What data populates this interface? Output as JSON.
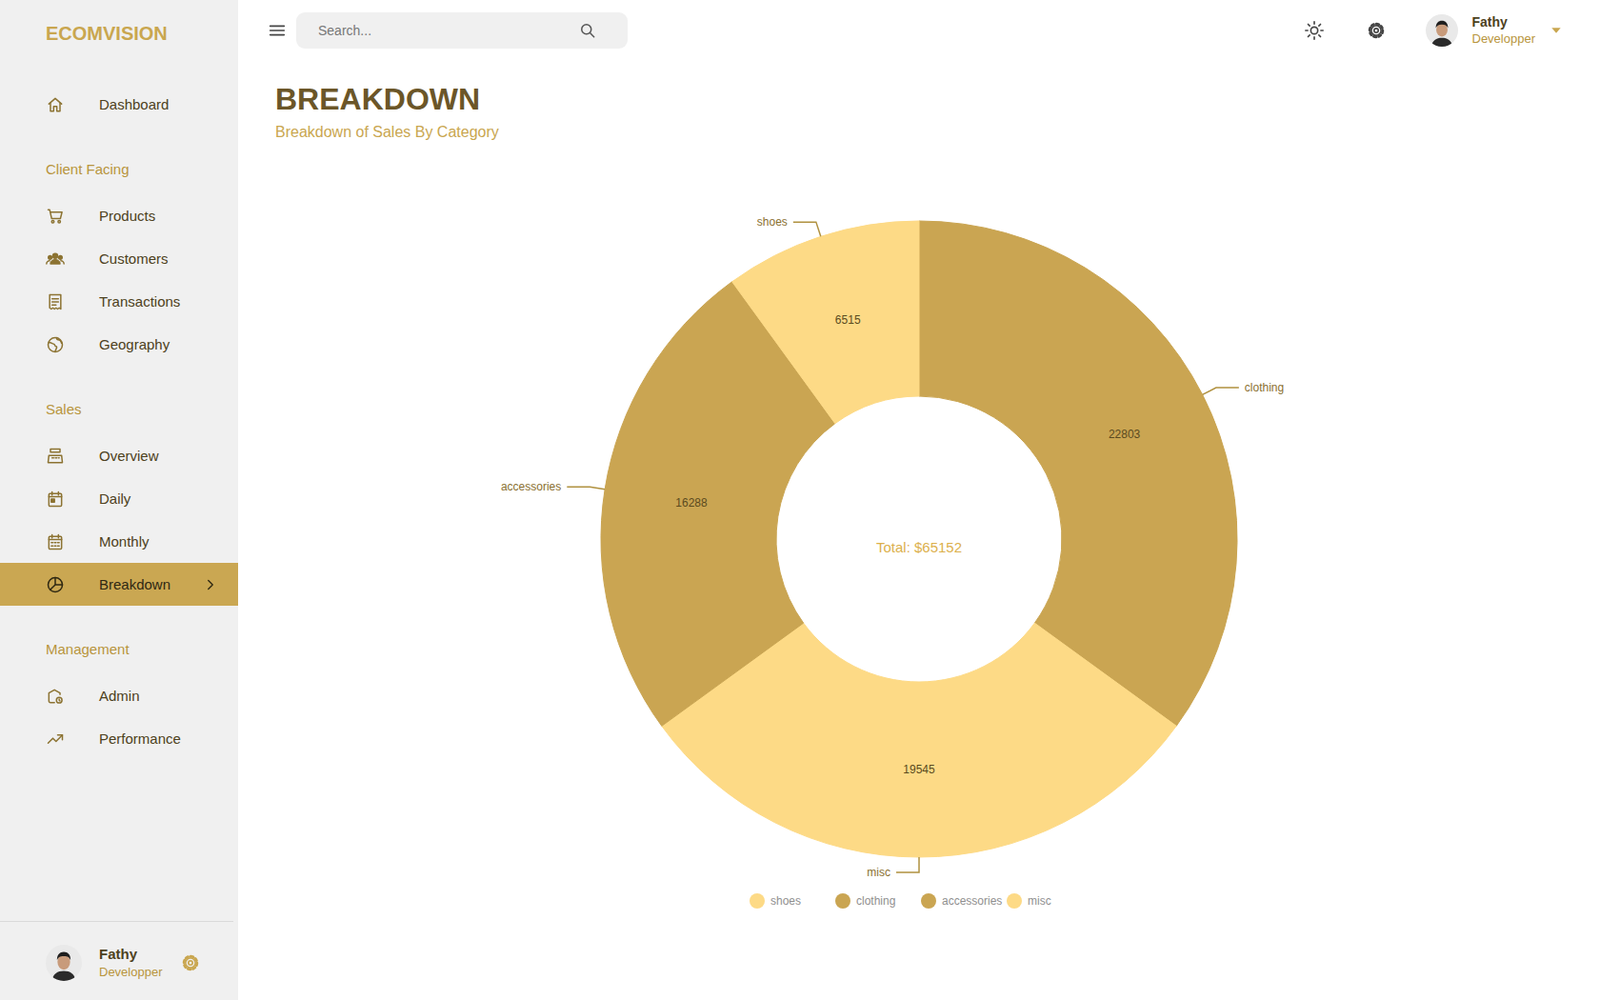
{
  "sidebar": {
    "logo": "ECOMVISION",
    "groups": [
      {
        "items": [
          {
            "label": "Dashboard",
            "selected": false
          }
        ]
      },
      {
        "heading": "Client Facing",
        "items": [
          {
            "label": "Products",
            "selected": false
          },
          {
            "label": "Customers",
            "selected": false
          },
          {
            "label": "Transactions",
            "selected": false
          },
          {
            "label": "Geography",
            "selected": false
          }
        ]
      },
      {
        "heading": "Sales",
        "items": [
          {
            "label": "Overview",
            "selected": false
          },
          {
            "label": "Daily",
            "selected": false
          },
          {
            "label": "Monthly",
            "selected": false
          },
          {
            "label": "Breakdown",
            "selected": true
          }
        ]
      },
      {
        "heading": "Management",
        "items": [
          {
            "label": "Admin",
            "selected": false
          },
          {
            "label": "Performance",
            "selected": false
          }
        ]
      }
    ],
    "profile": {
      "name": "Fathy",
      "role": "Developper"
    }
  },
  "topbar": {
    "search": {
      "placeholder": "Search..."
    },
    "profile": {
      "name": "Fathy",
      "role": "Developper"
    }
  },
  "page": {
    "title": "BREAKDOWN",
    "subtitle": "Breakdown of Sales By Category"
  },
  "chart": {
    "center_label": "Total: $65152",
    "values": [
      6515,
      22803,
      16288,
      19545
    ],
    "slices": [
      {
        "label": "shoes",
        "value_label": "6515",
        "color": "#fdda86"
      },
      {
        "label": "clothing",
        "value_label": "22803",
        "color": "#caa552"
      },
      {
        "label": "accessories",
        "value_label": "16288",
        "color": "#caa552"
      },
      {
        "label": "misc",
        "value_label": "19545",
        "color": "#fdda86"
      }
    ],
    "legend": [
      {
        "label": "shoes",
        "color": "#fdda86"
      },
      {
        "label": "clothing",
        "color": "#caa552"
      },
      {
        "label": "accessories",
        "color": "#caa552"
      },
      {
        "label": "misc",
        "color": "#fdda86"
      }
    ]
  }
}
